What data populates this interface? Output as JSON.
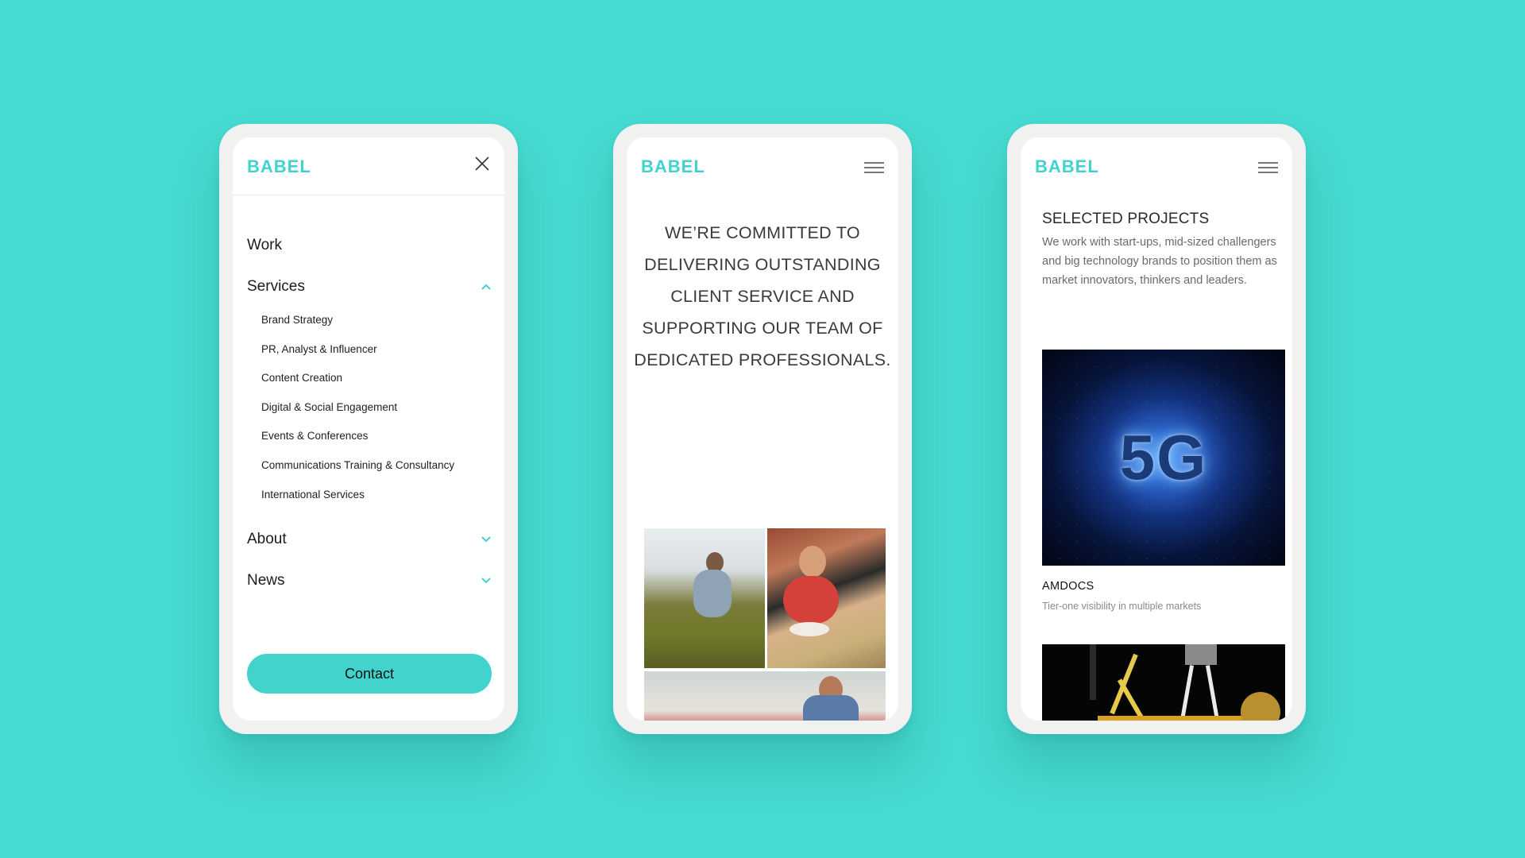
{
  "brand": {
    "name": "BABEL",
    "accent_color": "#41d3cc",
    "background_color": "#45dbd2"
  },
  "phone_menu": {
    "logo": "BABEL",
    "close_icon": "close-icon",
    "items": [
      {
        "label": "Work"
      },
      {
        "label": "Services",
        "expanded": true
      },
      {
        "label": "About",
        "expanded": false
      },
      {
        "label": "News",
        "expanded": false
      }
    ],
    "services_submenu": [
      "Brand Strategy",
      "PR, Analyst & Influencer",
      "Content Creation",
      "Digital & Social Engagement",
      "Events & Conferences",
      "Communications Training & Consultancy",
      "International Services"
    ],
    "contact_label": "Contact"
  },
  "phone_home": {
    "logo": "BABEL",
    "menu_icon": "hamburger-icon",
    "mission_lines": [
      "WE’RE COMMITTED TO",
      "DELIVERING OUTSTANDING",
      "CLIENT SERVICE AND",
      "SUPPORTING OUR TEAM OF",
      "DEDICATED PROFESSIONALS."
    ]
  },
  "phone_projects": {
    "logo": "BABEL",
    "menu_icon": "hamburger-icon",
    "section_title": "SELECTED PROJECTS",
    "section_description": "We work with start-ups, mid-sized challengers and big technology brands to position them as market innovators, thinkers and leaders.",
    "projects": [
      {
        "image_text": "5G",
        "name": "AMDOCS",
        "tagline": "Tier-one visibility in multiple markets"
      }
    ]
  }
}
